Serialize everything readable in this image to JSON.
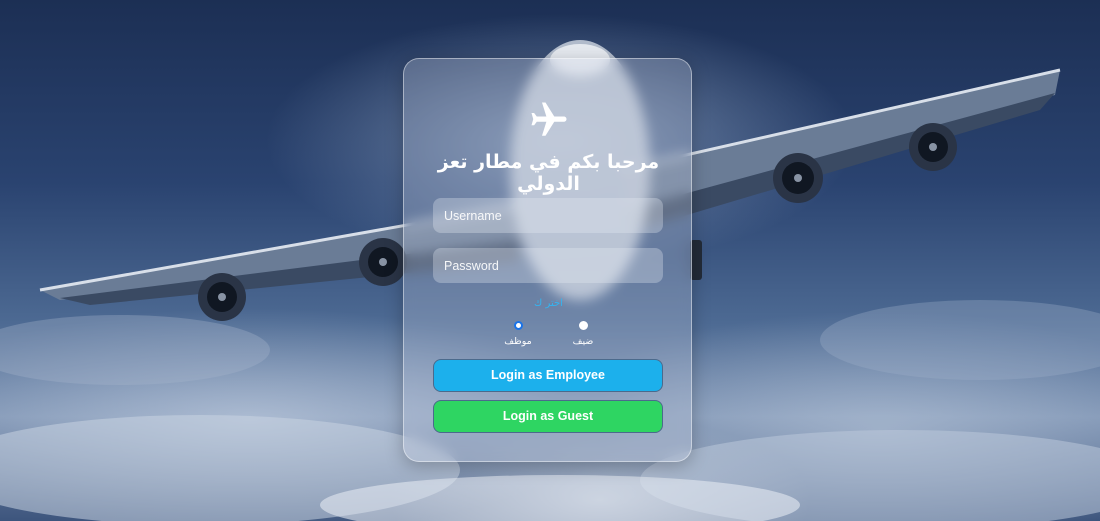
{
  "page": {
    "title": "مرحبا بكم في مطار تعز الدولي",
    "logo_icon": "airplane-icon"
  },
  "form": {
    "username_placeholder": "Username",
    "password_placeholder": "Password",
    "choose_label": "اختر ك",
    "roles": [
      {
        "label": "موظف",
        "selected": true
      },
      {
        "label": "ضيف",
        "selected": false
      }
    ]
  },
  "buttons": {
    "employee_label": "Login as Employee",
    "guest_label": "Login as Guest"
  },
  "colors": {
    "employee_button": "#1cb0ec",
    "guest_button": "#2ed562",
    "choose_text": "#35b4f0"
  }
}
